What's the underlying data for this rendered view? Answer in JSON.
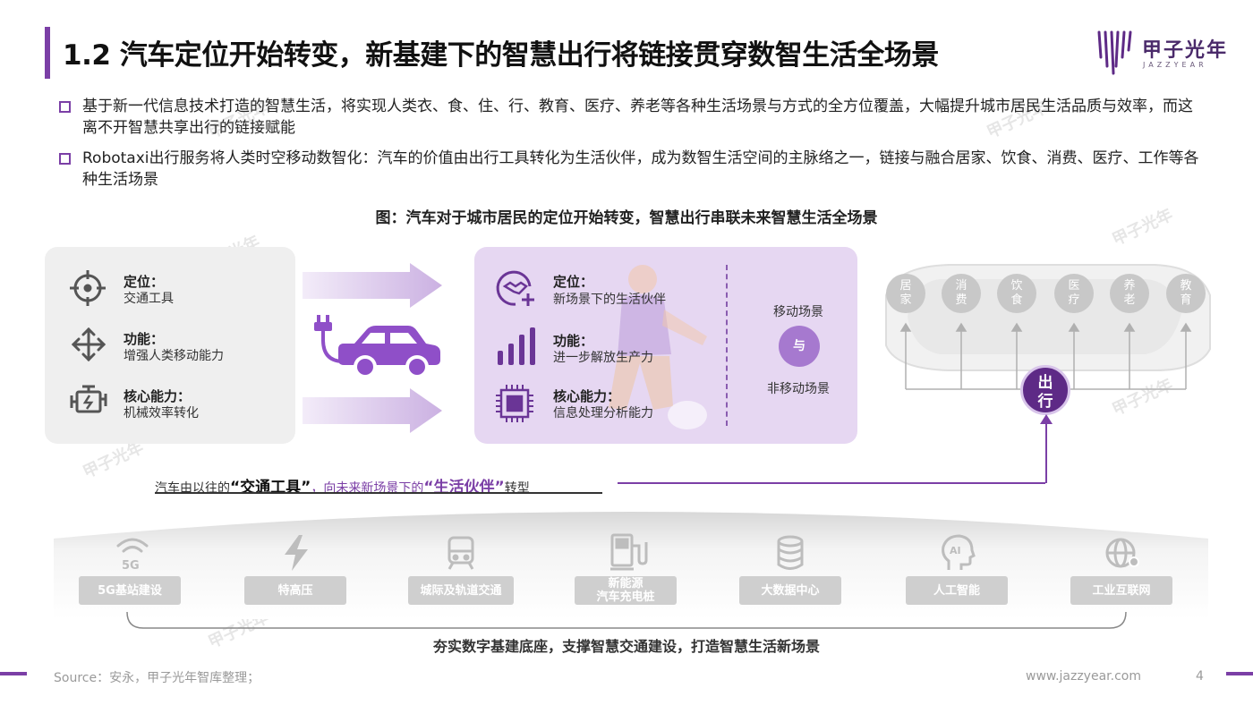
{
  "header": {
    "title": "1.2 汽车定位开始转变，新基建下的智慧出行将链接贯穿数智生活全场景",
    "logo_text": "甲子光年",
    "logo_sub": "JAZZYEAR"
  },
  "bullets": [
    "基于新一代信息技术打造的智慧生活，将实现人类衣、食、住、行、教育、医疗、养老等各种生活场景与方式的全方位覆盖，大幅提升城市居民生活品质与效率，而这离不开智慧共享出行的链接赋能",
    "Robotaxi出行服务将人类时空移动数智化：汽车的价值由出行工具转化为生活伙伴，成为数智生活空间的主脉络之一，链接与融合居家、饮食、消费、医疗、工作等各种生活场景"
  ],
  "figure_title": "图：汽车对于城市居民的定位开始转变，智慧出行串联未来智慧生活全场景",
  "left_panel": {
    "items": [
      {
        "label": "定位：",
        "desc": "交通工具",
        "icon": "target-icon"
      },
      {
        "label": "功能：",
        "desc": "增强人类移动能力",
        "icon": "move-arrows-icon"
      },
      {
        "label": "核心能力：",
        "desc": "机械效率转化",
        "icon": "engine-icon"
      }
    ]
  },
  "purple_panel": {
    "items": [
      {
        "label": "定位：",
        "desc": "新场景下的生活伙伴",
        "icon": "handshake-icon"
      },
      {
        "label": "功能：",
        "desc": "进一步解放生产力",
        "icon": "bar-chart-icon"
      },
      {
        "label": "核心能力：",
        "desc": "信息处理分析能力",
        "icon": "chip-icon"
      }
    ],
    "scene_top": "移动场景",
    "connector": "与",
    "scene_bottom": "非移动场景"
  },
  "right_scenes": [
    {
      "l1": "居",
      "l2": "家"
    },
    {
      "l1": "消",
      "l2": "费"
    },
    {
      "l1": "饮",
      "l2": "食"
    },
    {
      "l1": "医",
      "l2": "疗"
    },
    {
      "l1": "养",
      "l2": "老"
    },
    {
      "l1": "教",
      "l2": "育"
    }
  ],
  "hub": {
    "l1": "出",
    "l2": "行"
  },
  "transition": {
    "part1": "汽车由以往的",
    "term1": "“交通工具”",
    "part2": "，向未来新场景下的",
    "term2": "“生活伙伴”",
    "part3": "转型"
  },
  "infra": [
    {
      "label": "5G基站建设",
      "icon": "5g-icon"
    },
    {
      "label": "特高压",
      "icon": "lightning-icon"
    },
    {
      "label": "城际及轨道交通",
      "icon": "train-icon"
    },
    {
      "label_l1": "新能源",
      "label_l2": "汽车充电桩",
      "icon": "charging-pile-icon"
    },
    {
      "label": "大数据中心",
      "icon": "database-icon"
    },
    {
      "label": "人工智能",
      "icon": "ai-head-icon"
    },
    {
      "label": "工业互联网",
      "icon": "globe-network-icon"
    }
  ],
  "bottom_caption": "夯实数字基建底座，支撑智慧交通建设，打造智慧生活新场景",
  "footer": {
    "source": "Source：安永，甲子光年智库整理；",
    "website": "www.jazzyear.com",
    "page": "4"
  },
  "watermark": "甲子光年",
  "colors": {
    "accent": "#7b3fa6",
    "panel": "#e6d7f2",
    "hub": "#5e2a86",
    "grey": "#c8c8c8"
  }
}
